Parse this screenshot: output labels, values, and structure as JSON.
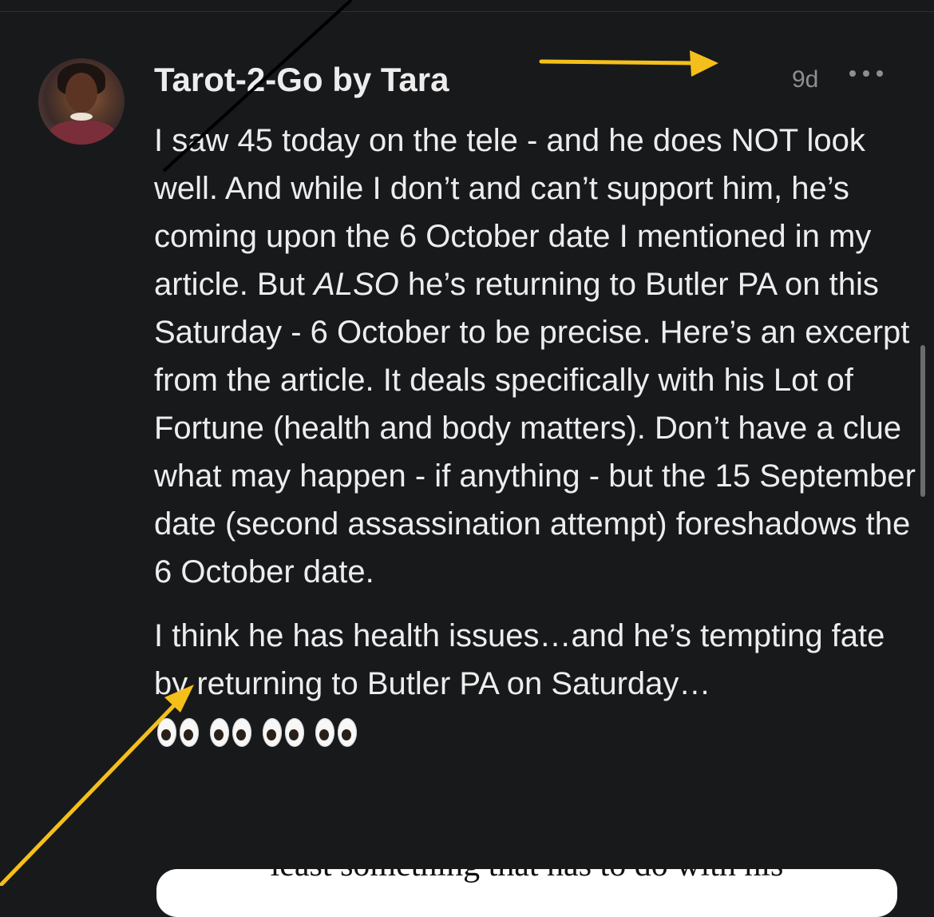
{
  "comment": {
    "author": "Tarot-2-Go by Tara",
    "time": "9d",
    "avatar_icon": "profile-photo",
    "more_icon": "ellipsis-icon",
    "paragraph_1": {
      "before_emphasis": "I saw 45 today on the tele - and he does NOT look well. And while I don’t and can’t support him, he’s coming upon the 6 October date I mentioned in my article. But ",
      "emphasis": "ALSO",
      "after_emphasis": " he’s returning to Butler PA on this Saturday - 6 October to be precise. Here’s an excerpt from the article. It deals specifically with his Lot of Fortune (health and body matters). Don’t have a clue what may happen - if anything - but the 15 September date (second assassination attempt) foreshadows the 6 October date."
    },
    "paragraph_2": {
      "text": "I think he has health issues…and he’s tempting fate by returning to Butler PA on Saturday…",
      "emoji": "eyes-emoji",
      "emoji_count": 4
    }
  },
  "excerpt_card": {
    "text": "least something that has to do with his"
  },
  "colors": {
    "background": "#18191b",
    "text": "#ededed",
    "muted": "#8d8f93",
    "annotation_yellow": "#f5bf1b",
    "annotation_black": "#000000"
  },
  "annotations": [
    "yellow-arrow-right",
    "yellow-arrow-diagonal",
    "black-diagonal-line"
  ]
}
